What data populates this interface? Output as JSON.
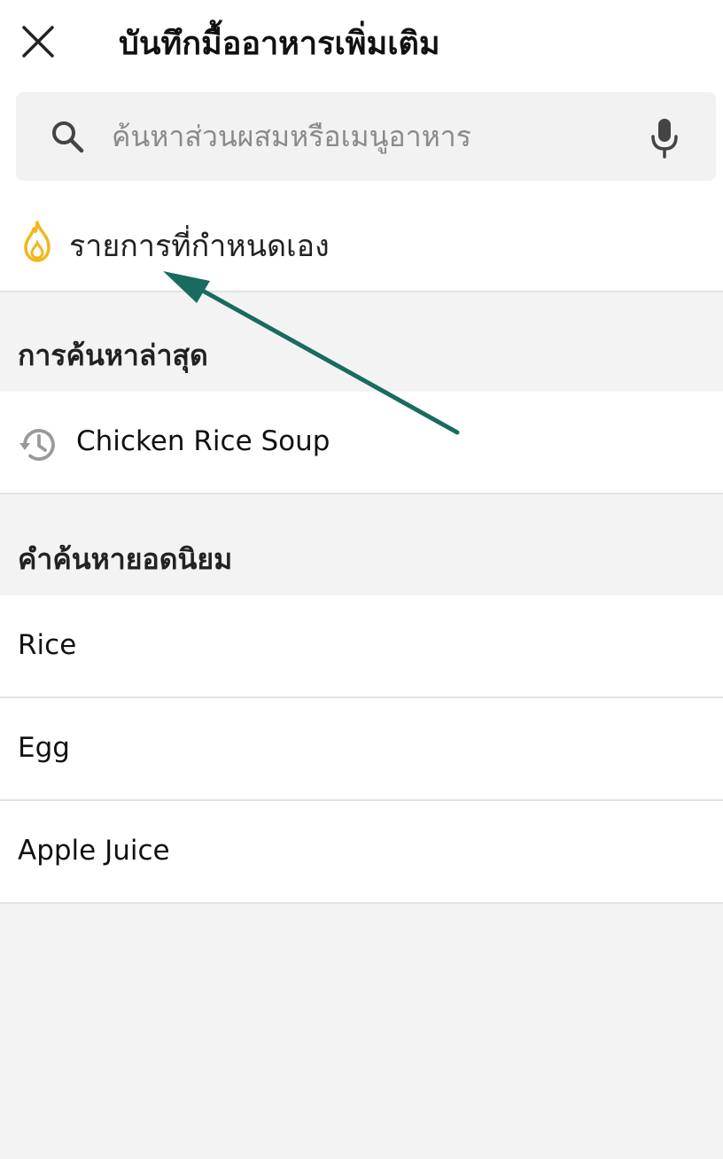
{
  "header": {
    "title": "บันทึกมื้ออาหารเพิ่มเติม",
    "close_icon": "close-icon"
  },
  "search": {
    "placeholder": "ค้นหาส่วนผสมหรือเมนูอาหาร",
    "value": "",
    "search_icon": "search-icon",
    "mic_icon": "microphone-icon"
  },
  "custom_items": {
    "label": "รายการที่กำหนดเอง",
    "icon": "flame-icon",
    "icon_color": "#F2B71A"
  },
  "recent_searches": {
    "title": "การค้นหาล่าสุด",
    "items": [
      {
        "label": "Chicken Rice Soup",
        "icon": "history-icon"
      }
    ]
  },
  "popular_searches": {
    "title": "คำค้นหายอดนิยม",
    "items": [
      {
        "label": "Rice"
      },
      {
        "label": "Egg"
      },
      {
        "label": "Apple Juice"
      }
    ]
  },
  "annotation": {
    "arrow_color": "#1A6B5F"
  }
}
